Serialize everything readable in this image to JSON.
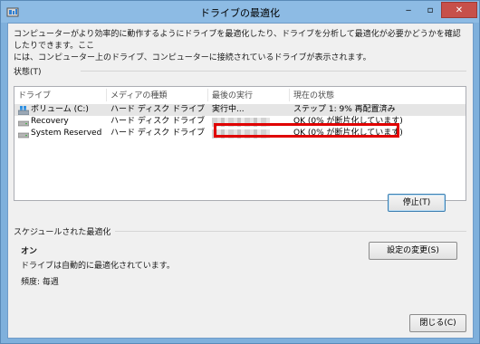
{
  "window": {
    "title": "ドライブの最適化",
    "minimize_glyph": "‒",
    "maximize_glyph": "▫",
    "close_glyph": "✕"
  },
  "description": {
    "line1": "コンピューターがより効率的に動作するようにドライブを最適化したり、ドライブを分析して最適化が必要かどうかを確認したりできます。ここ",
    "line2": "には、コンピューター上のドライブ、コンピューターに接続されているドライブが表示されます。"
  },
  "status_group": {
    "label": "状態(T)"
  },
  "table": {
    "columns": [
      "ドライブ",
      "メディアの種類",
      "最後の実行",
      "現在の状態"
    ],
    "rows": [
      {
        "drive": "ボリューム (C:)",
        "media": "ハード ディスク ドライブ",
        "last_run": "実行中...",
        "status": "ステップ 1: 9% 再配置済み",
        "icon": "system-drive-icon"
      },
      {
        "drive": "Recovery",
        "media": "ハード ディスク ドライブ",
        "last_run": "",
        "status": "OK (0% が断片化しています)",
        "icon": "hard-drive-icon"
      },
      {
        "drive": "System Reserved",
        "media": "ハード ディスク ドライブ",
        "last_run": "",
        "status": "OK (0% が断片化しています)",
        "icon": "hard-drive-icon"
      }
    ]
  },
  "buttons": {
    "stop": "停止(T)",
    "change_settings": "設定の変更(S)",
    "close": "閉じる(C)"
  },
  "schedule": {
    "label": "スケジュールされた最適化",
    "state": "オン",
    "auto_text": "ドライブは自動的に最適化されています。",
    "frequency": "頻度: 毎週"
  },
  "colors": {
    "title_bar": "#8dbbe4",
    "close_button": "#c7504a",
    "highlight_box": "#e00000",
    "selected_row": "#e5e5e5"
  }
}
